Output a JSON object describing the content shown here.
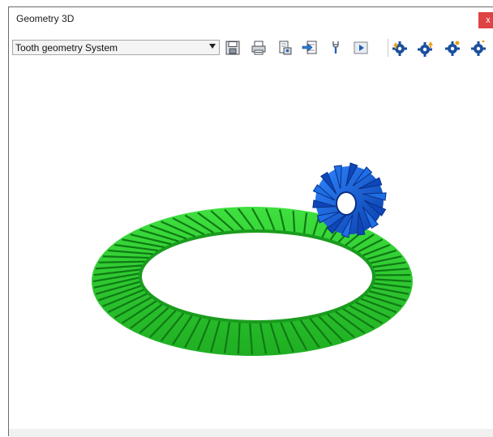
{
  "window": {
    "title": "Geometry 3D",
    "close_label": "x"
  },
  "toolbar": {
    "system_select": {
      "value": "Tooth geometry System"
    },
    "buttons": [
      {
        "icon": "save-icon"
      },
      {
        "icon": "print-icon"
      },
      {
        "icon": "print-preview-icon"
      },
      {
        "icon": "export-icon"
      },
      {
        "icon": "wrench-icon"
      },
      {
        "icon": "play-icon"
      },
      {
        "icon": "gear-arrow-up-icon"
      },
      {
        "icon": "gear-arrow-up-double-icon"
      },
      {
        "icon": "gear-icon"
      },
      {
        "icon": "gear-dual-icon"
      }
    ]
  },
  "colors": {
    "ring_gear": "#2fd02f",
    "ring_gear_dark": "#0f7a14",
    "pinion": "#1560d6",
    "pinion_dark": "#0a2f86",
    "gear_icon_blue": "#1b4f9e",
    "gear_icon_arrow": "#e8a11a",
    "close_button": "#e04343"
  }
}
